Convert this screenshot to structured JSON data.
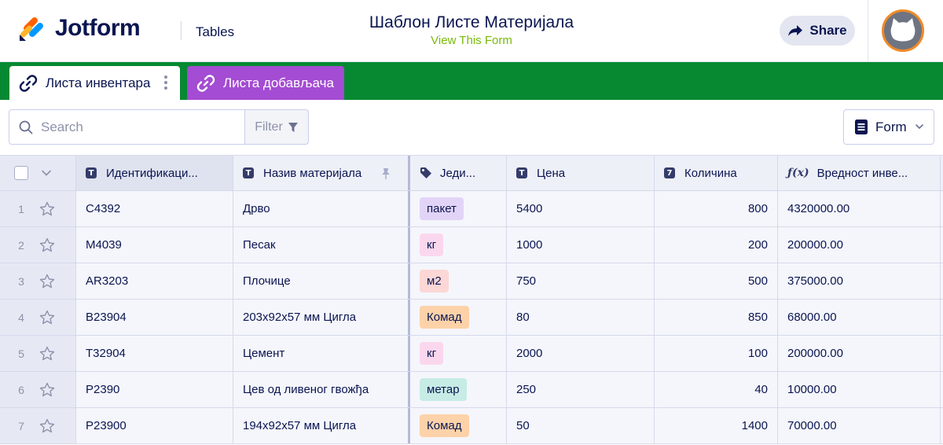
{
  "header": {
    "logo_text": "Jotform",
    "product": "Tables",
    "form_title": "Шаблон Листе Материјала",
    "view_form": "View This Form",
    "share_label": "Share"
  },
  "tabs": [
    {
      "label": "Листа инвентара",
      "active": true
    },
    {
      "label": "Листа добављача",
      "active": false
    }
  ],
  "toolbar": {
    "search_placeholder": "Search",
    "filter_label": "Filter",
    "form_label": "Form"
  },
  "columns": [
    {
      "label": "Идентификаци...",
      "icon": "text-type-icon"
    },
    {
      "label": "Назив материјала",
      "icon": "text-type-icon"
    },
    {
      "label": "Једи...",
      "icon": "tag-icon"
    },
    {
      "label": "Цена",
      "icon": "text-type-icon"
    },
    {
      "label": "Количина",
      "icon": "number-type-icon"
    },
    {
      "label": "Вредност инве...",
      "icon": "formula-icon"
    }
  ],
  "rows": [
    {
      "num": "1",
      "id": "C4392",
      "name": "Дрво",
      "unit": "пакет",
      "unit_color": "#e2d4f7",
      "price": "5400",
      "qty": "800",
      "value": "4320000.00"
    },
    {
      "num": "2",
      "id": "M4039",
      "name": "Песак",
      "unit": "кг",
      "unit_color": "#fbd7ee",
      "price": "1000",
      "qty": "200",
      "value": "200000.00"
    },
    {
      "num": "3",
      "id": "AR3203",
      "name": "Плочице",
      "unit": "м2",
      "unit_color": "#fcd7d6",
      "price": "750",
      "qty": "500",
      "value": "375000.00"
    },
    {
      "num": "4",
      "id": "B23904",
      "name": "203x92x57 мм Цигла",
      "unit": "Комад",
      "unit_color": "#fdd2a9",
      "price": "80",
      "qty": "850",
      "value": "68000.00"
    },
    {
      "num": "5",
      "id": "T32904",
      "name": "Цемент",
      "unit": "кг",
      "unit_color": "#fbd7ee",
      "price": "2000",
      "qty": "100",
      "value": "200000.00"
    },
    {
      "num": "6",
      "id": "P2390",
      "name": "Цев од ливеног гвожђа",
      "unit": "метар",
      "unit_color": "#c6ece5",
      "price": "250",
      "qty": "40",
      "value": "10000.00"
    },
    {
      "num": "7",
      "id": "P23900",
      "name": "194x92x57 мм Цигла",
      "unit": "Комад",
      "unit_color": "#fdd2a9",
      "price": "50",
      "qty": "1400",
      "value": "70000.00"
    }
  ]
}
